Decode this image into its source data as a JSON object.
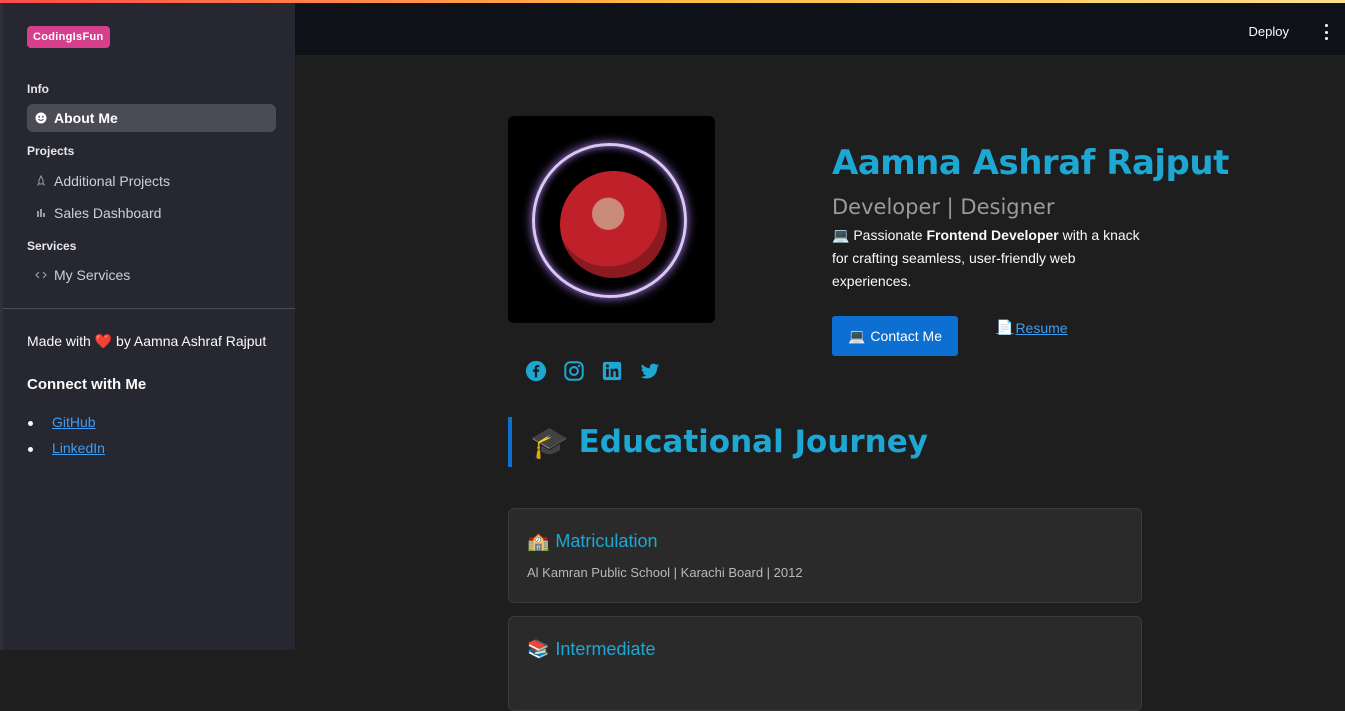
{
  "app": {
    "logo": "CodingIsFun"
  },
  "sidebar": {
    "sections": [
      {
        "label": "Info"
      },
      {
        "label": "Projects"
      },
      {
        "label": "Services"
      }
    ],
    "items": [
      {
        "label": "About Me",
        "icon": "smiley-icon"
      },
      {
        "label": "Additional Projects",
        "icon": "rocket-icon"
      },
      {
        "label": "Sales Dashboard",
        "icon": "bar-chart-icon"
      },
      {
        "label": "My Services",
        "icon": "code-icon"
      }
    ],
    "made_with_prefix": "Made with",
    "made_with_heart": "❤️",
    "made_with_suffix": "by Aamna Ashraf Rajput",
    "connect_title": "Connect with Me",
    "links": [
      {
        "label": "GitHub"
      },
      {
        "label": "LinkedIn"
      }
    ]
  },
  "header": {
    "deploy_label": "Deploy"
  },
  "profile": {
    "name": "Aamna Ashraf Rajput",
    "role": "Developer | Designer",
    "bio_icon": "💻",
    "bio_pre": "Passionate",
    "bio_bold": "Frontend Developer",
    "bio_post": "with a knack for crafting seamless, user-friendly web experiences.",
    "contact_icon": "💻",
    "contact_label": "Contact Me",
    "resume_icon": "📄",
    "resume_label": "Resume",
    "socials": [
      "facebook-icon",
      "instagram-icon",
      "linkedin-icon",
      "twitter-icon"
    ]
  },
  "education": {
    "title_icon": "🎓",
    "title": "Educational Journey",
    "cards": [
      {
        "icon": "🏫",
        "title": "Matriculation",
        "subtitle": "Al Kamran Public School | Karachi Board | 2012"
      },
      {
        "icon": "📚",
        "title": "Intermediate",
        "subtitle": ""
      }
    ]
  },
  "colors": {
    "accent": "#1fa7d4",
    "button": "#0d6fd1",
    "sidebar_bg": "#262730",
    "main_bg": "#1e1e1e",
    "header_bg": "#0e1117",
    "logo_bg": "#d63f8c"
  }
}
